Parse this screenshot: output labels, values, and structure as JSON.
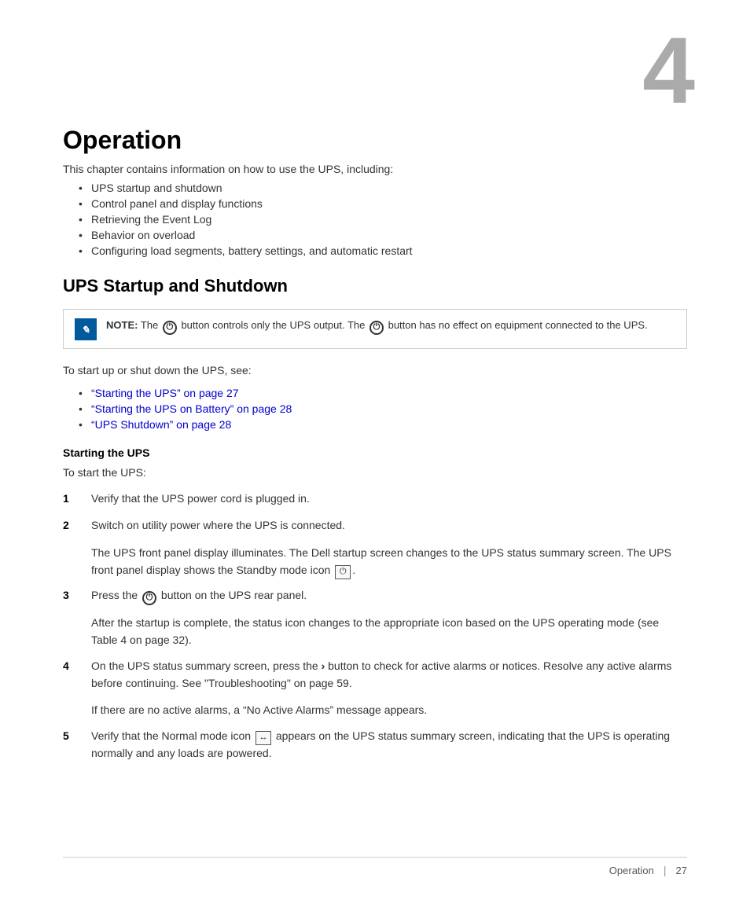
{
  "page": {
    "chapter_number": "4",
    "chapter_title": "Operation",
    "intro_text": "This chapter contains information on how to use the UPS, including:",
    "bullet_items": [
      "UPS startup and shutdown",
      "Control panel and display functions",
      "Retrieving the Event Log",
      "Behavior on overload",
      "Configuring load segments, battery settings, and automatic restart"
    ],
    "section1_title": "UPS Startup and Shutdown",
    "note_label": "NOTE:",
    "note_text": " The  button controls only the UPS output. The  button has no effect on equipment connected to the UPS.",
    "see_text": "To start up or shut down the UPS, see:",
    "see_items": [
      "“Starting the UPS” on page 27",
      "“Starting the UPS on Battery” on page 28",
      "“UPS Shutdown” on page 28"
    ],
    "subsection1_title": "Starting the UPS",
    "subsection1_intro": "To start the UPS:",
    "steps": [
      {
        "number": "1",
        "text": "Verify that the UPS power cord is plugged in."
      },
      {
        "number": "2",
        "text": "Switch on utility power where the UPS is connected.",
        "subtext": "The UPS front panel display illuminates. The Dell startup screen changes to the UPS status summary screen. The UPS front panel display shows the Standby mode icon  □."
      },
      {
        "number": "3",
        "text": "Press the  button on the UPS rear panel.",
        "subtext": "After the startup is complete, the status icon changes to the appropriate icon based on the UPS operating mode (see Table 4 on page 32)."
      },
      {
        "number": "4",
        "text": "On the UPS status summary screen, press the › button to check for active alarms or notices. Resolve any active alarms before continuing. See “Troubleshooting” on page 59.",
        "subtext": "If there are no active alarms, a “No Active Alarms” message appears."
      },
      {
        "number": "5",
        "text": "Verify that the Normal mode icon  □ appears on the UPS status summary screen, indicating that the UPS is operating normally and any loads are powered."
      }
    ],
    "footer": {
      "section_label": "Operation",
      "separator": "|",
      "page_number": "27"
    }
  }
}
